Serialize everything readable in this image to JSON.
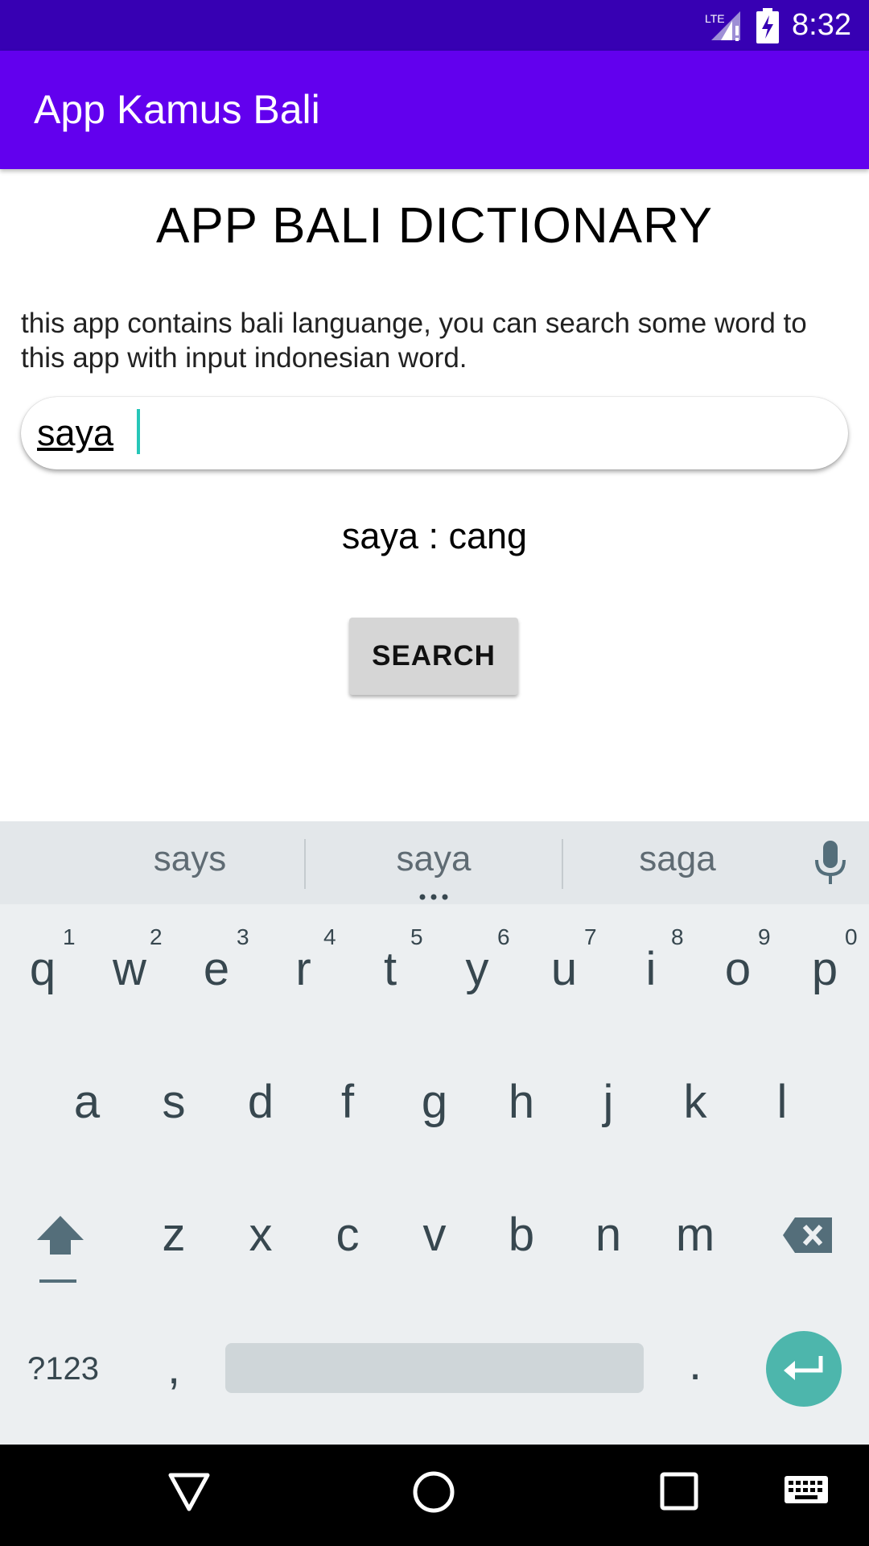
{
  "status_bar": {
    "network": "LTE",
    "time": "8:32"
  },
  "app_bar": {
    "title": "App Kamus Bali"
  },
  "main": {
    "heading": "APP BALI DICTIONARY",
    "description": "this app contains bali languange, you can search some word to this app with input indonesian word.",
    "search_input_value": "saya",
    "result": "saya : cang",
    "search_button_label": "SEARCH"
  },
  "keyboard": {
    "suggestions": [
      "says",
      "saya",
      "saga"
    ],
    "row1": [
      "q",
      "w",
      "e",
      "r",
      "t",
      "y",
      "u",
      "i",
      "o",
      "p"
    ],
    "row1_numbers": [
      "1",
      "2",
      "3",
      "4",
      "5",
      "6",
      "7",
      "8",
      "9",
      "0"
    ],
    "row2": [
      "a",
      "s",
      "d",
      "f",
      "g",
      "h",
      "j",
      "k",
      "l"
    ],
    "row3": [
      "z",
      "x",
      "c",
      "v",
      "b",
      "n",
      "m"
    ],
    "symbols_label": "?123",
    "comma": ",",
    "period": "."
  },
  "colors": {
    "status_bar": "#3700b3",
    "app_bar": "#6200ee",
    "enter_key": "#4db6ac",
    "caret": "#26c6b8"
  }
}
